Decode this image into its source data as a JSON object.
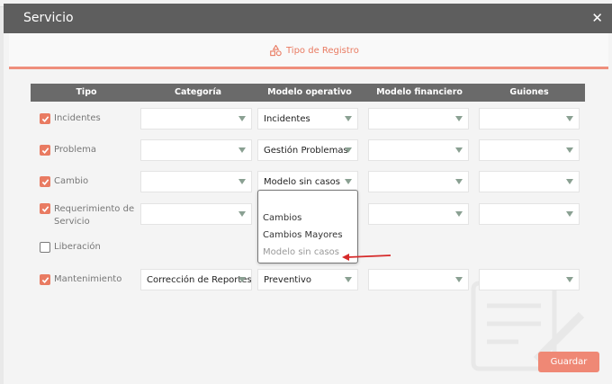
{
  "modal": {
    "title": "Servicio",
    "close_glyph": "✕",
    "tab_label": "Tipo de Registro",
    "tab_icon": "shapes-icon",
    "accent": "#e97b62",
    "save_label": "Guardar"
  },
  "columns": [
    "Tipo",
    "Categoría",
    "Modelo operativo",
    "Modelo financiero",
    "Guiones"
  ],
  "rows": [
    {
      "label": "Incidentes",
      "checked": true,
      "categoria": "",
      "modelo_operativo": "Incidentes",
      "modelo_financiero": "",
      "guiones": ""
    },
    {
      "label": "Problema",
      "checked": true,
      "categoria": "",
      "modelo_operativo": "Gestión Problemas",
      "modelo_financiero": "",
      "guiones": ""
    },
    {
      "label": "Cambio",
      "checked": true,
      "categoria": "",
      "modelo_operativo": "Modelo sin casos",
      "modelo_financiero": "",
      "guiones": ""
    },
    {
      "label_line1": "Requerimiento de",
      "label_line2": "Servicio",
      "checked": true,
      "categoria": "",
      "modelo_financiero": "",
      "guiones": ""
    },
    {
      "label": "Liberación",
      "checked": false
    },
    {
      "label": "Mantenimiento",
      "checked": true,
      "categoria": "Corrección de Reportes",
      "modelo_operativo": "Preventivo",
      "modelo_financiero": "",
      "guiones": ""
    }
  ],
  "dropdown": {
    "options": [
      "Cambios",
      "Cambios Mayores",
      "Modelo sin casos"
    ]
  }
}
